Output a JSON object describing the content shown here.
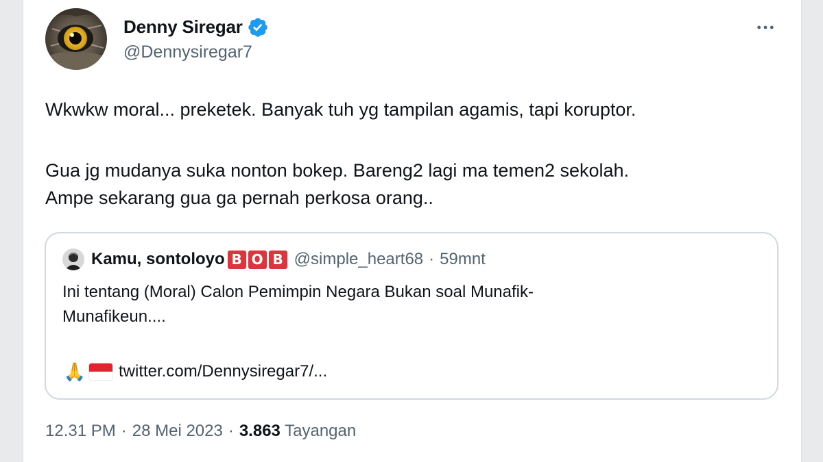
{
  "author": {
    "name": "Denny Siregar",
    "handle": "@Dennysiregar7",
    "verified_color": "#1d9bf0",
    "avatar_icon": "owl-eye-avatar"
  },
  "tweet": {
    "line1": "Wkwkw moral... preketek. Banyak tuh yg tampilan agamis, tapi koruptor.",
    "line2": "Gua jg mudanya suka nonton bokep. Bareng2 lagi ma temen2 sekolah.",
    "line3": "Ampe sekarang gua ga pernah perkosa orang.."
  },
  "quote": {
    "name": "Kamu, sontoloyo",
    "badges": [
      "B",
      "O",
      "B"
    ],
    "handle": "@simple_heart68",
    "separator": "·",
    "time": "59mnt",
    "text_line1": "Ini tentang (Moral) Calon Pemimpin Negara Bukan soal  Munafik-",
    "text_line2": "Munafikeun....",
    "emoji_pray": "🙏",
    "link": "twitter.com/Dennysiregar7/..."
  },
  "meta": {
    "time": "12.31 PM",
    "sep1": "·",
    "date": "28 Mei 2023",
    "sep2": "·",
    "views_count": "3.863",
    "views_label": "Tayangan"
  },
  "icons": {
    "more": "more-horizontal-icon",
    "verified": "verified-badge-icon"
  }
}
